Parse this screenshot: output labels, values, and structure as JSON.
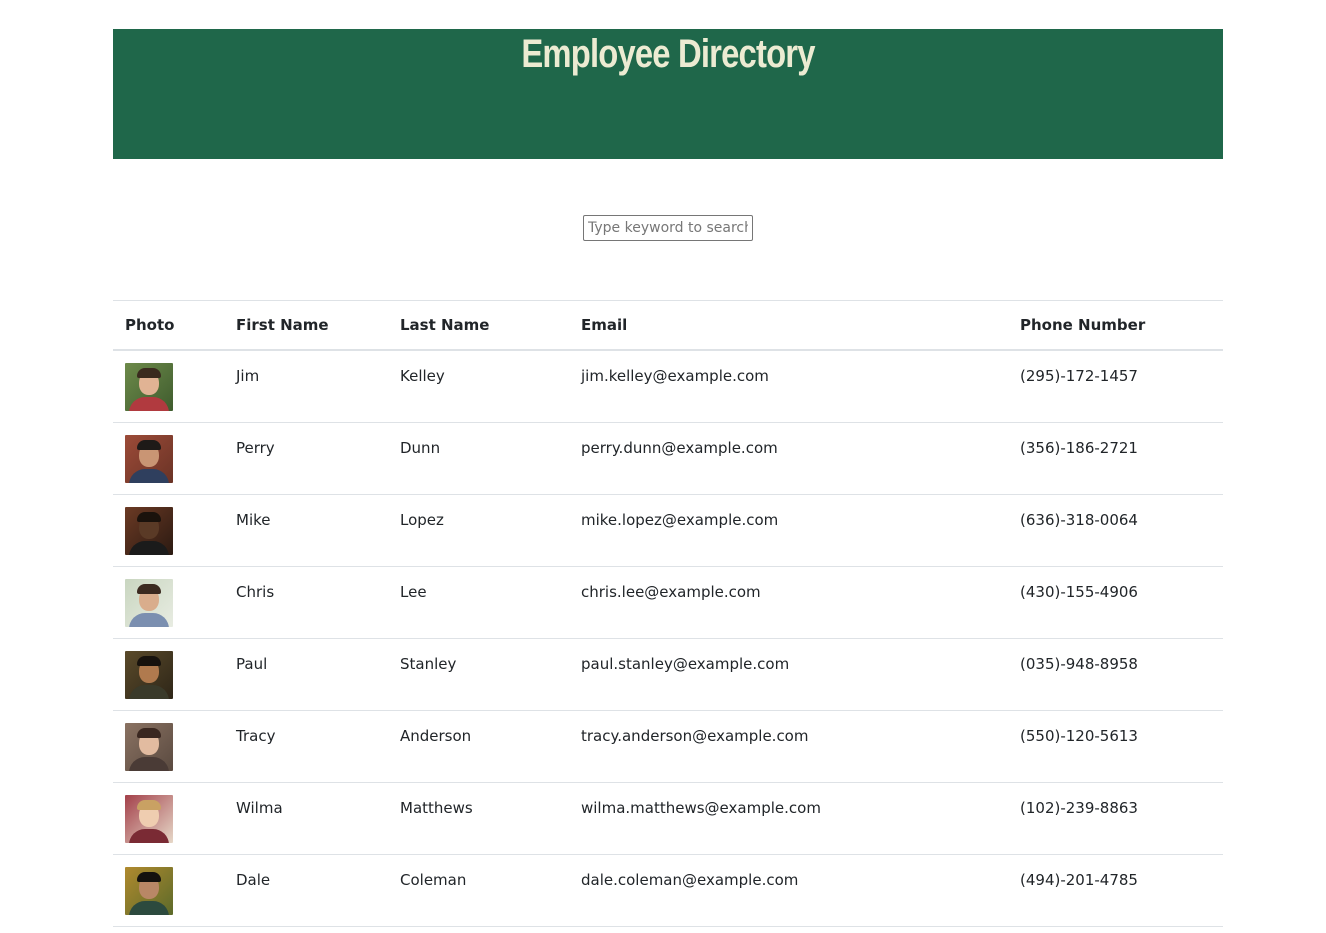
{
  "header": {
    "title": "Employee Directory"
  },
  "search": {
    "placeholder": "Type keyword to search"
  },
  "table": {
    "headers": {
      "photo": "Photo",
      "first_name": "First Name",
      "last_name": "Last Name",
      "email": "Email",
      "phone": "Phone Number"
    },
    "rows": [
      {
        "first": "Jim",
        "last": "Kelley",
        "email": "jim.kelley@example.com",
        "phone": "(295)-172-1457"
      },
      {
        "first": "Perry",
        "last": "Dunn",
        "email": "perry.dunn@example.com",
        "phone": "(356)-186-2721"
      },
      {
        "first": "Mike",
        "last": "Lopez",
        "email": "mike.lopez@example.com",
        "phone": "(636)-318-0064"
      },
      {
        "first": "Chris",
        "last": "Lee",
        "email": "chris.lee@example.com",
        "phone": "(430)-155-4906"
      },
      {
        "first": "Paul",
        "last": "Stanley",
        "email": "paul.stanley@example.com",
        "phone": "(035)-948-8958"
      },
      {
        "first": "Tracy",
        "last": "Anderson",
        "email": "tracy.anderson@example.com",
        "phone": "(550)-120-5613"
      },
      {
        "first": "Wilma",
        "last": "Matthews",
        "email": "wilma.matthews@example.com",
        "phone": "(102)-239-8863"
      },
      {
        "first": "Dale",
        "last": "Coleman",
        "email": "dale.coleman@example.com",
        "phone": "(494)-201-4785"
      }
    ]
  },
  "colors": {
    "header_bg": "#1f674a",
    "header_text": "#ecebd2"
  }
}
